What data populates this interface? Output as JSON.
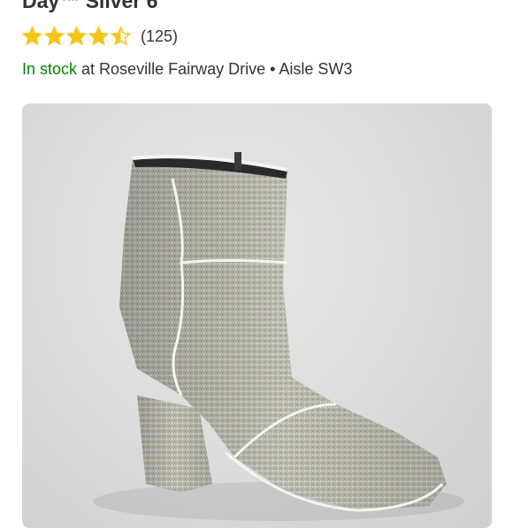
{
  "product": {
    "title": "Day™ Silver 6",
    "rating": 4.5,
    "rating_max": 5,
    "review_count": "(125)",
    "stock_status": "In stock",
    "store_prefix": " at ",
    "store": "Roseville Fairway Drive",
    "separator": " • ",
    "aisle": "Aisle SW3",
    "image_icon": "product-photo"
  },
  "colors": {
    "star": "#f5c518",
    "stock": "#008300",
    "text": "#333333"
  }
}
